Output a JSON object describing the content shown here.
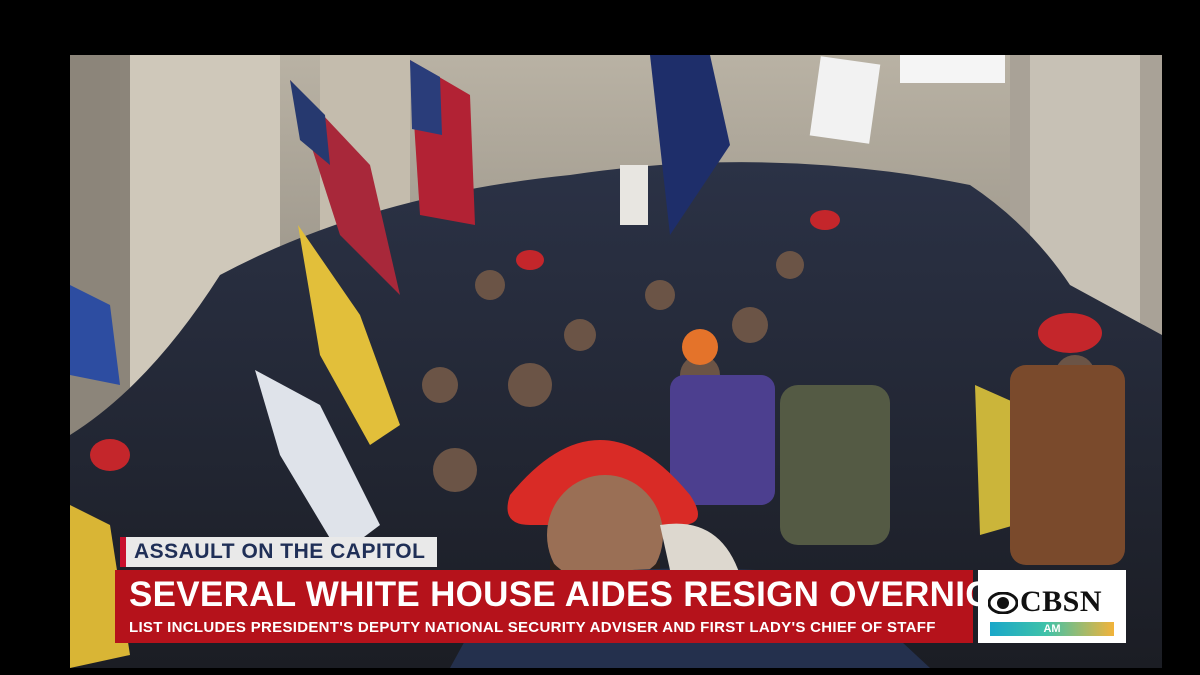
{
  "broadcast": {
    "kicker": "ASSAULT ON THE CAPITOL",
    "headline": "SEVERAL WHITE HOUSE AIDES RESIGN OVERNIGHT",
    "subline": "LIST INCLUDES PRESIDENT'S DEPUTY NATIONAL SECURITY ADVISER AND FIRST LADY'S CHIEF OF STAFF"
  },
  "network": {
    "logo": "CBSN",
    "program": "AM"
  },
  "colors": {
    "banner_red": "#b5121b",
    "kicker_bg": "#e9e9e9",
    "kicker_text": "#1f2f57"
  }
}
